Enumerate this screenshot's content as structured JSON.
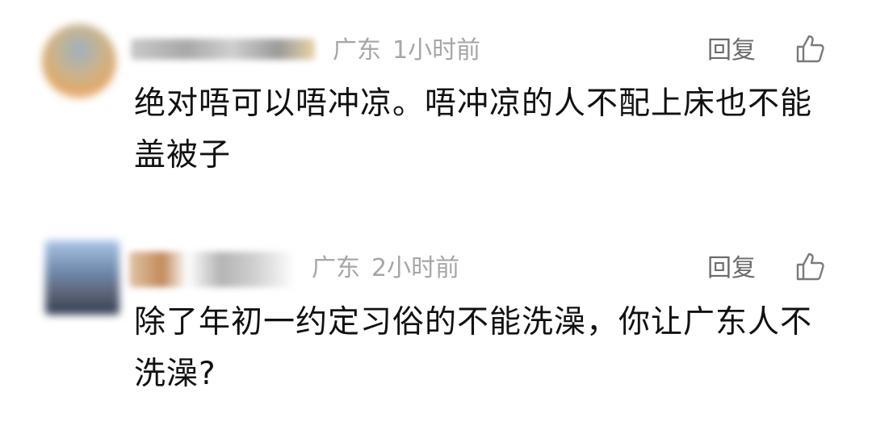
{
  "comments": [
    {
      "location": "广东",
      "time": "1小时前",
      "reply_label": "回复",
      "like_icon": "thumbs-up-icon",
      "text": "绝对唔可以唔冲凉。唔冲凉的人不配上床也不能盖被子"
    },
    {
      "location": "广东",
      "time": "2小时前",
      "reply_label": "回复",
      "like_icon": "thumbs-up-icon",
      "text": "除了年初一约定习俗的不能洗澡，你让广东人不洗澡?"
    }
  ],
  "colors": {
    "meta_text": "#a6a6a6",
    "reply_text": "#6b6b6b",
    "body_text": "#111111",
    "background": "#ffffff"
  }
}
